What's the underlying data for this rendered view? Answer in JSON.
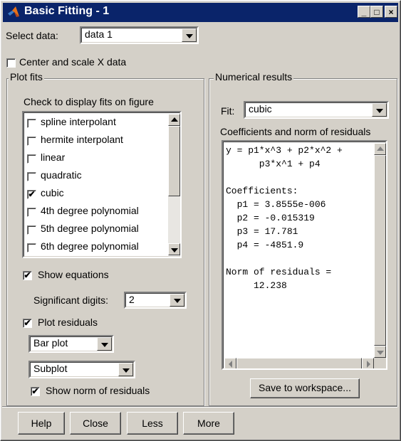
{
  "window": {
    "title": "Basic Fitting - 1",
    "title_bar_color": "#0a246a",
    "face_color": "#d4d0c8",
    "controls": {
      "minimize": "_",
      "maximize": "□",
      "close": "×"
    }
  },
  "select_data": {
    "label": "Select data:",
    "value": "data 1"
  },
  "center_scale": {
    "label": "Center and scale X data",
    "checked": false
  },
  "plot_fits": {
    "group_title": "Plot fits",
    "list_caption": "Check to display fits on figure",
    "items": [
      {
        "label": "spline interpolant",
        "checked": false
      },
      {
        "label": "hermite interpolant",
        "checked": false
      },
      {
        "label": "linear",
        "checked": false
      },
      {
        "label": "quadratic",
        "checked": false
      },
      {
        "label": "cubic",
        "checked": true
      },
      {
        "label": "4th degree polynomial",
        "checked": false
      },
      {
        "label": "5th degree polynomial",
        "checked": false
      },
      {
        "label": "6th degree polynomial",
        "checked": false
      }
    ],
    "show_equations": {
      "label": "Show equations",
      "checked": true
    },
    "significant_digits": {
      "label": "Significant digits:",
      "value": "2"
    },
    "plot_residuals": {
      "label": "Plot residuals",
      "checked": true
    },
    "residual_plot_type": "Bar plot",
    "residual_location": "Subplot",
    "show_norm": {
      "label": "Show norm of residuals",
      "checked": true
    }
  },
  "numerical_results": {
    "group_title": "Numerical results",
    "fit_label": "Fit:",
    "fit_value": "cubic",
    "caption": "Coefficients and norm of residuals",
    "text": "y = p1*x^3 + p2*x^2 +\n      p3*x^1 + p4\n\nCoefficients:\n  p1 = 3.8555e-006\n  p2 = -0.015319\n  p3 = 17.781\n  p4 = -4851.9\n\nNorm of residuals =\n     12.238",
    "save_button": "Save to workspace..."
  },
  "footer": {
    "buttons": [
      "Help",
      "Close",
      "Less",
      "More"
    ]
  }
}
